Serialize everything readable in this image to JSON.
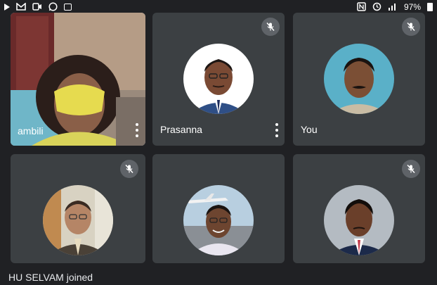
{
  "status_bar": {
    "icons": [
      "play-icon",
      "gmail-icon",
      "video-icon",
      "whatsapp-icon",
      "gallery-icon"
    ],
    "right_icons": [
      "nfc-icon",
      "alarm-icon",
      "signal-icon"
    ],
    "battery": "97%"
  },
  "participants": [
    {
      "name": "ambili",
      "muted": false,
      "video_on": true,
      "active_speaker": true,
      "has_menu": true
    },
    {
      "name": "Prasanna",
      "muted": true,
      "video_on": false,
      "has_menu": true
    },
    {
      "name": "You",
      "muted": true,
      "video_on": false,
      "has_menu": false
    },
    {
      "name": "",
      "muted": true,
      "video_on": false
    },
    {
      "name": "",
      "muted": false,
      "video_on": false
    },
    {
      "name": "",
      "muted": true,
      "video_on": false
    }
  ],
  "toast": {
    "text": "HU SELVAM joined"
  },
  "colors": {
    "background": "#202124",
    "tile": "#3c4043",
    "active_outline": "#8ab4f8",
    "mic_badge": "#5f6368"
  }
}
